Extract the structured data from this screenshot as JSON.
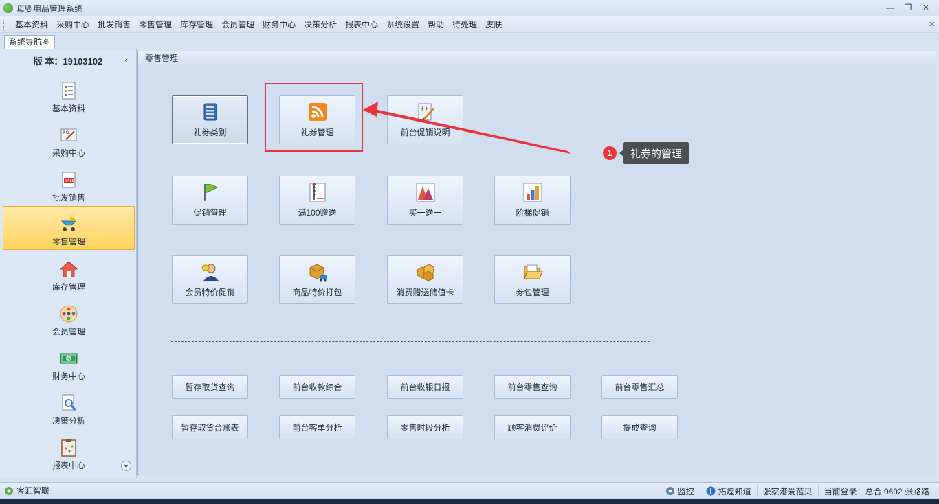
{
  "window": {
    "title": "母婴用品管理系统",
    "controls": [
      "—",
      "❐",
      "✕"
    ]
  },
  "menu": {
    "items": [
      "基本资料",
      "采购中心",
      "批发销售",
      "零售管理",
      "库存管理",
      "会员管理",
      "财务中心",
      "决策分析",
      "报表中心",
      "系统设置",
      "帮助",
      "待处理",
      "皮肤"
    ],
    "close": "✕"
  },
  "tabs": {
    "nav": "系统导航图"
  },
  "sidebar": {
    "version": "版 本：19103102",
    "items": [
      {
        "label": "基本资料",
        "icon": "document-list-icon"
      },
      {
        "label": "采购中心",
        "icon": "purchase-order-icon"
      },
      {
        "label": "批发销售",
        "icon": "sale-tag-icon"
      },
      {
        "label": "零售管理",
        "icon": "baby-stroller-icon",
        "active": true
      },
      {
        "label": "库存管理",
        "icon": "house-icon"
      },
      {
        "label": "会员管理",
        "icon": "member-group-icon"
      },
      {
        "label": "财务中心",
        "icon": "money-icon"
      },
      {
        "label": "决策分析",
        "icon": "analysis-icon"
      },
      {
        "label": "报表中心",
        "icon": "report-icon"
      }
    ]
  },
  "panel": {
    "title": "零售管理",
    "functions": [
      {
        "label": "礼券类别",
        "icon": "list-icon"
      },
      {
        "label": "礼券管理",
        "icon": "rss-icon"
      },
      {
        "label": "前台促销说明",
        "icon": "script-edit-icon"
      },
      {
        "label": "促销管理",
        "icon": "flag-icon"
      },
      {
        "label": "满100赠送",
        "icon": "ruler-chart-icon"
      },
      {
        "label": "买一送一",
        "icon": "peaks-icon"
      },
      {
        "label": "阶梯促销",
        "icon": "bar-chart-icon"
      },
      {
        "label": "会员特价促销",
        "icon": "member-mask-icon"
      },
      {
        "label": "商品特价打包",
        "icon": "box-cart-icon"
      },
      {
        "label": "消费赠送储值卡",
        "icon": "boxes-icon"
      },
      {
        "label": "券包管理",
        "icon": "folder-open-icon"
      }
    ],
    "queries": [
      "暂存取货查询",
      "前台收款综合",
      "前台收银日报",
      "前台零售查询",
      "前台零售汇总",
      "暂存取货台账表",
      "前台客单分析",
      "零售时段分析",
      "顾客消费评价",
      "提成查询"
    ]
  },
  "annotation": {
    "number": "1",
    "text": "礼券的管理",
    "color": "#e8343a"
  },
  "status": {
    "left": "客汇智联",
    "right": [
      "监控",
      "拓煌知道",
      "张家港爱蓓贝",
      "当前登录：总合 0692 张路路"
    ]
  }
}
